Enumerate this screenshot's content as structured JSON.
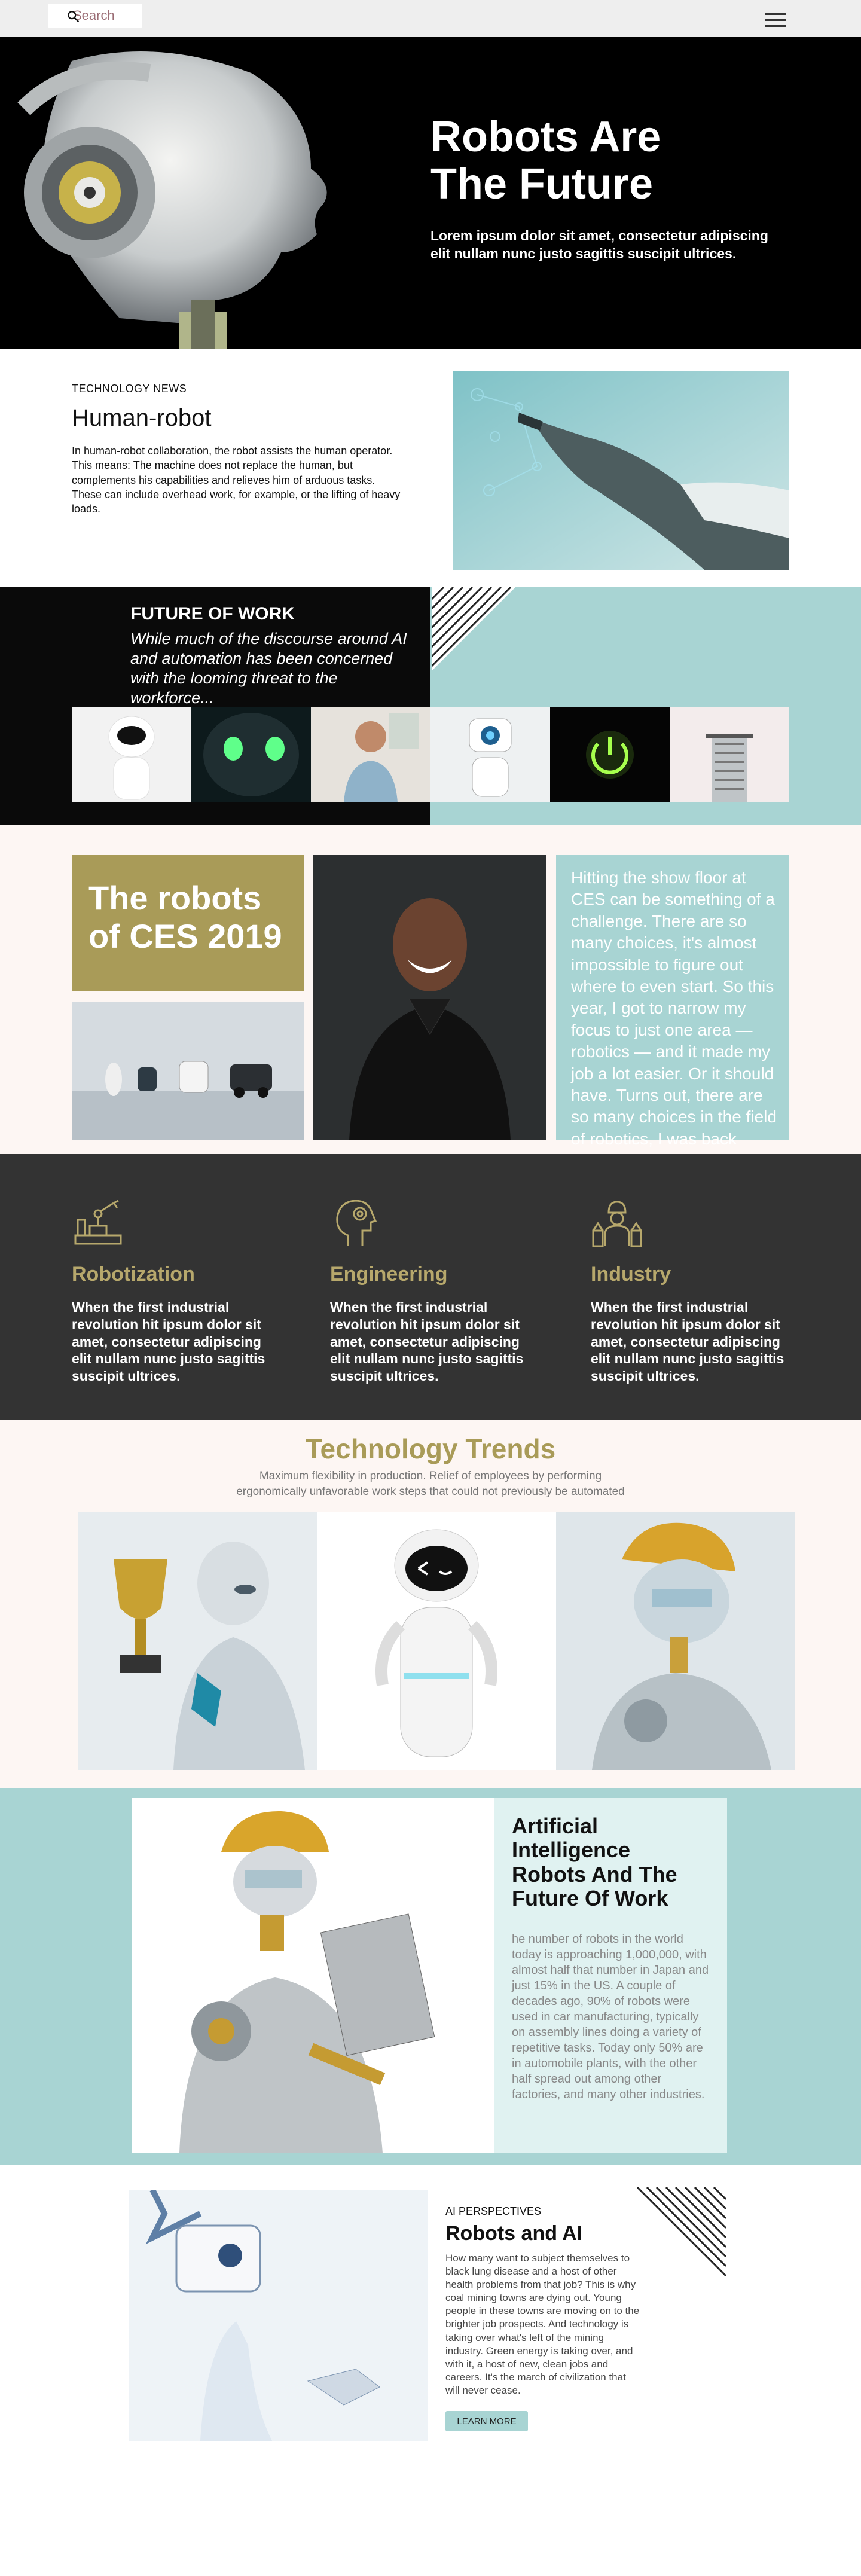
{
  "colors": {
    "accent_gold": "#a99b58",
    "teal": "#a8d4d3",
    "light_teal": "#e0f2f1",
    "dark": "#333333",
    "blush": "#fdf6f3"
  },
  "topbar": {
    "search_placeholder": "Search",
    "search_icon": "search-icon",
    "menu_icon": "hamburger-menu-icon"
  },
  "hero": {
    "title": "Robots Are\nThe Future",
    "subtitle": "Lorem ipsum dolor sit amet, consectetur adipiscing elit nullam nunc justo sagittis suscipit ultrices."
  },
  "news": {
    "tag": "TECHNOLOGY NEWS",
    "title": "Human-robot",
    "body": "In human-robot collaboration, the robot assists the human operator. This means: The machine does not replace the human, but complements his capabilities and relieves him of arduous tasks. These can include overhead work, for example, or the lifting of heavy loads."
  },
  "future_of_work": {
    "title": "FUTURE OF WORK",
    "subtitle": "While much of the discourse around AI and automation has been concerned with the looming threat to the workforce..."
  },
  "ces": {
    "title": "The robots\nof CES 2019",
    "text": "Hitting the show floor at CES can be something of a challenge. There are so many choices, it's almost impossible to figure out where to even start. So this year, I got to narrow my focus to just one area — robotics — and it made my job a lot easier. Or it should have. Turns out, there are so many choices in the field of robotics, I was back where I started."
  },
  "features": [
    {
      "icon": "robotic-arm-icon",
      "title": "Robotization",
      "body": "When the first industrial revolution hit ipsum dolor sit amet, consectetur adipiscing elit nullam nunc justo sagittis suscipit ultrices."
    },
    {
      "icon": "head-gear-icon",
      "title": "Engineering",
      "body": "When the first industrial revolution hit ipsum dolor sit amet, consectetur adipiscing elit nullam nunc justo sagittis suscipit ultrices."
    },
    {
      "icon": "factory-worker-icon",
      "title": "Industry",
      "body": "When the first industrial revolution hit ipsum dolor sit amet, consectetur adipiscing elit nullam nunc justo sagittis suscipit ultrices."
    }
  ],
  "trends": {
    "title": "Technology Trends",
    "subtitle": "Maximum flexibility in production. Relief of employees by performing\nergonomically unfavorable work steps that could not previously be automated"
  },
  "ai_feature": {
    "title": "Artificial Intelligence Robots And The Future Of Work",
    "body": "he number of robots in the world today is approaching 1,000,000, with almost half that number in Japan and just 15% in the US. A couple of decades ago, 90% of robots were used in car manufacturing, typically on assembly lines doing a variety of repetitive tasks. Today only 50% are in automobile plants, with the other half spread out among other factories, and many other industries."
  },
  "robots_and_ai": {
    "tag": "AI PERSPECTIVES",
    "title": "Robots and AI",
    "body": "How many want to subject themselves to black lung disease and a host of other health problems from that job? This is why coal mining towns are dying out. Young people in these towns are moving on to the brighter job prospects. And technology is taking over what's left of the mining industry. Green energy is taking over, and with it, a host of new, clean jobs and careers. It's the march of civilization that will never cease.",
    "button": "LEARN MORE"
  }
}
